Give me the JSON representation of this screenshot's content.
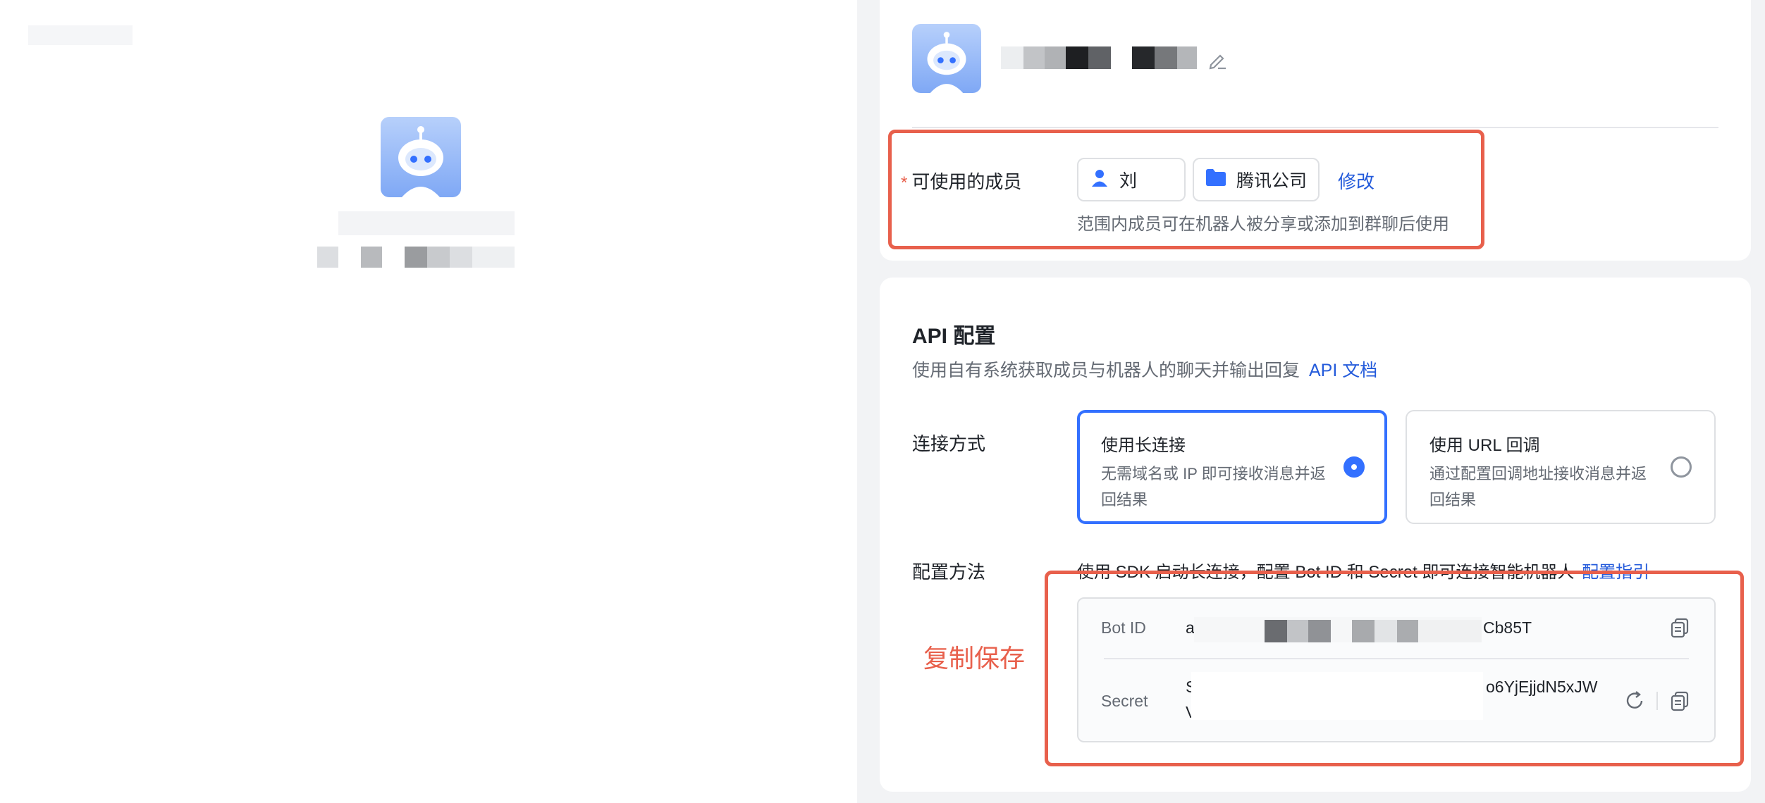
{
  "members": {
    "label": "可使用的成员",
    "required_mark": "*",
    "user_chip": "刘",
    "org_chip": "腾讯公司",
    "modify_link": "修改",
    "hint": "范围内成员可在机器人被分享或添加到群聊后使用"
  },
  "api": {
    "title": "API 配置",
    "description": "使用自有系统获取成员与机器人的聊天并输出回复",
    "doc_link": "API 文档",
    "connection_label": "连接方式",
    "options": [
      {
        "title": "使用长连接",
        "desc": "无需域名或 IP 即可接收消息并返回结果",
        "selected": true
      },
      {
        "title": "使用 URL 回调",
        "desc": "通过配置回调地址接收消息并返回结果",
        "selected": false
      }
    ],
    "config_label": "配置方法",
    "config_text": "使用 SDK 启动长连接，配置 Bot ID 和 Secret 即可连接智能机器人",
    "config_link": "配置指引",
    "bot_id_key": "Bot ID",
    "bot_id_prefix": "a",
    "bot_id_suffix": "Cb85T",
    "secret_key": "Secret",
    "secret_prefix": "S",
    "secret_suffix": "o6YjEjjdN5xJW",
    "secret_line2": "Vm"
  },
  "annotation": "复制保存",
  "colors": {
    "accent": "#3370ff",
    "link": "#245bdb",
    "annotation_red": "#e8604c",
    "avatar_blue": "#8db4f7"
  },
  "icons": [
    "robot-avatar-icon",
    "edit-pencil-icon",
    "user-icon",
    "folder-icon",
    "radio-icon",
    "refresh-icon",
    "copy-icon"
  ]
}
